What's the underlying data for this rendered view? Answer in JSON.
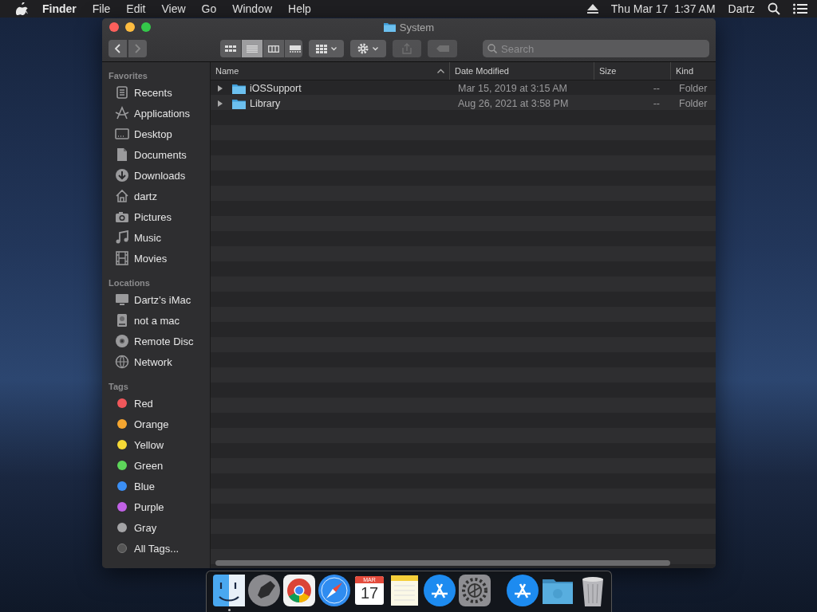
{
  "menu_bar": {
    "app_name": "Finder",
    "menus": [
      "File",
      "Edit",
      "View",
      "Go",
      "Window",
      "Help"
    ],
    "clock": "Thu Mar 17  1:37 AM",
    "user": "Dartz"
  },
  "window": {
    "title": "System",
    "toolbar": {
      "view_modes": [
        {
          "selected": false
        },
        {
          "selected": true
        },
        {
          "selected": false
        },
        {
          "selected": false
        }
      ],
      "search": {
        "placeholder": "Search"
      }
    },
    "sidebar": [
      {
        "heading": "Favorites",
        "items": [
          {
            "kind": "place",
            "label": "Recents"
          },
          {
            "kind": "place",
            "label": "Applications"
          },
          {
            "kind": "place",
            "label": "Desktop"
          },
          {
            "kind": "place",
            "label": "Documents"
          },
          {
            "kind": "place",
            "label": "Downloads"
          },
          {
            "kind": "place",
            "label": "dartz"
          },
          {
            "kind": "place",
            "label": "Pictures"
          },
          {
            "kind": "place",
            "label": "Music"
          },
          {
            "kind": "place",
            "label": "Movies"
          }
        ]
      },
      {
        "heading": "Locations",
        "items": [
          {
            "kind": "place",
            "label": "Dartz’s iMac"
          },
          {
            "kind": "place",
            "label": "not a mac"
          },
          {
            "kind": "place",
            "label": "Remote Disc"
          },
          {
            "kind": "place",
            "label": "Network"
          }
        ]
      },
      {
        "heading": "Tags",
        "items": [
          {
            "kind": "tag",
            "label": "Red",
            "color": "#f0575b"
          },
          {
            "kind": "tag",
            "label": "Orange",
            "color": "#f5a630"
          },
          {
            "kind": "tag",
            "label": "Yellow",
            "color": "#f5d936"
          },
          {
            "kind": "tag",
            "label": "Green",
            "color": "#5dd65a"
          },
          {
            "kind": "tag",
            "label": "Blue",
            "color": "#3b8ff5"
          },
          {
            "kind": "tag",
            "label": "Purple",
            "color": "#c161e6"
          },
          {
            "kind": "tag",
            "label": "Gray",
            "color": "#a4a4a6"
          },
          {
            "kind": "all_tags",
            "label": "All Tags..."
          }
        ]
      }
    ],
    "file_list": {
      "columns": [
        {
          "label": "Name",
          "sorted": true
        },
        {
          "label": "Date Modified",
          "sorted": false
        },
        {
          "label": "Size",
          "sorted": false
        },
        {
          "label": "Kind",
          "sorted": false
        }
      ],
      "rows": [
        {
          "name": "iOSSupport",
          "date_modified": "Mar 15, 2019 at 3:15 AM",
          "size": "--",
          "kind": "Folder",
          "expanded": false
        },
        {
          "name": "Library",
          "date_modified": "Aug 26, 2021 at 3:58 PM",
          "size": "--",
          "kind": "Folder",
          "expanded": false
        }
      ]
    }
  },
  "dock": {
    "apps": [
      {
        "running": true
      },
      {
        "running": false
      },
      {
        "running": false
      },
      {
        "running": false
      },
      {
        "running": false
      },
      {
        "running": false
      },
      {
        "running": false
      },
      {
        "running": false
      }
    ],
    "calendar": {
      "month": "MAR",
      "day": "17"
    }
  }
}
